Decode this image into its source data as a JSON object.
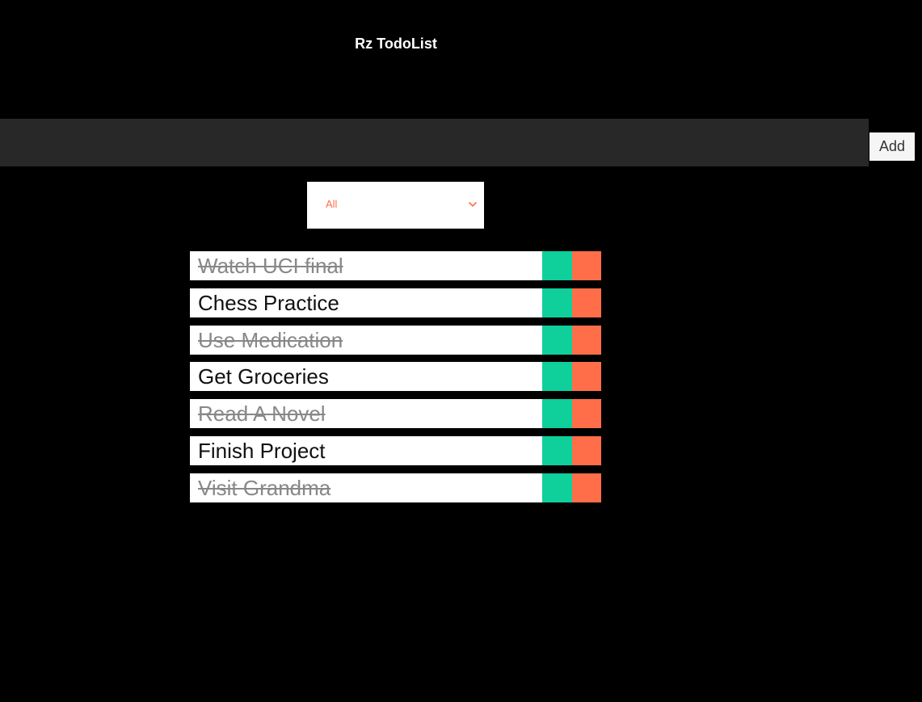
{
  "header": {
    "title": "Rz TodoList"
  },
  "form": {
    "input_value": "",
    "input_placeholder": "",
    "add_label": "Add"
  },
  "filter": {
    "selected": "All"
  },
  "todos": [
    {
      "text": "Watch UCI final",
      "completed": true
    },
    {
      "text": "Chess Practice",
      "completed": false
    },
    {
      "text": "Use Medication",
      "completed": true
    },
    {
      "text": "Get Groceries",
      "completed": false
    },
    {
      "text": "Read A Novel",
      "completed": true
    },
    {
      "text": "Finish Project",
      "completed": false
    },
    {
      "text": "Visit Grandma",
      "completed": true
    }
  ],
  "icons": {
    "complete_button": "check-icon",
    "delete_button": "trash-icon",
    "filter_dropdown": "chevron-down-icon"
  },
  "colors": {
    "background": "#000000",
    "input_bar": "#282828",
    "complete": "#0fcf9b",
    "delete": "#ff6e48",
    "filter_text": "#ff6e48"
  }
}
